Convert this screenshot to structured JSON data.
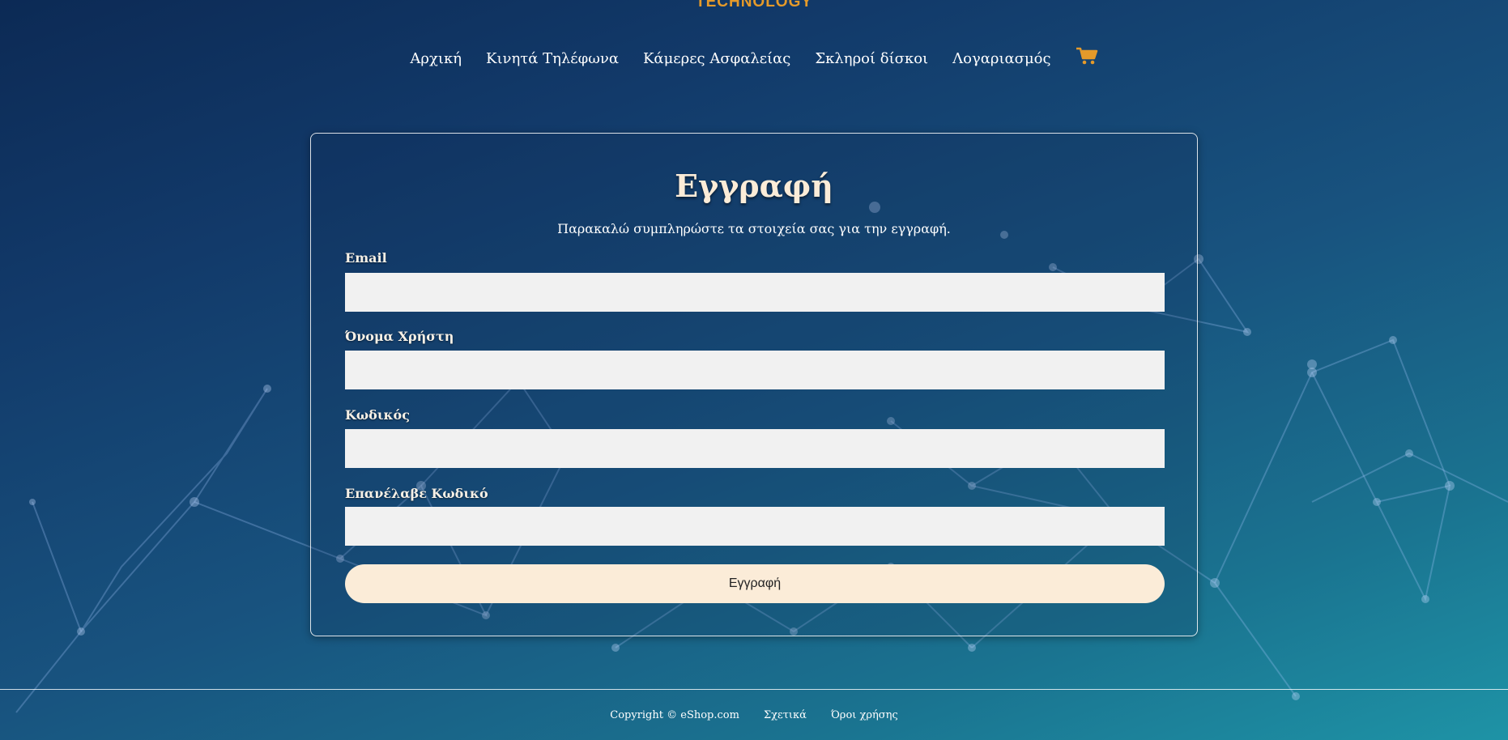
{
  "logo": {
    "text": "TECHNOLOGY"
  },
  "nav": {
    "items": [
      "Αρχική",
      "Κινητά Τηλέφωνα",
      "Κάμερες Ασφαλείας",
      "Σκληροί δίσκοι",
      "Λογαριασμός"
    ],
    "cart_icon": "cart-icon"
  },
  "form": {
    "title": "Εγγραφή",
    "subtitle": "Παρακαλώ συμπληρώστε τα στοιχεία σας για την εγγραφή.",
    "fields": [
      {
        "label": "Email",
        "value": "",
        "placeholder": ""
      },
      {
        "label": "Όνομα Χρήστη",
        "value": "",
        "placeholder": ""
      },
      {
        "label": "Κωδικός",
        "value": "",
        "placeholder": ""
      },
      {
        "label": "Επανέλαβε Κωδικό",
        "value": "",
        "placeholder": ""
      }
    ],
    "submit_label": "Εγγραφή"
  },
  "footer": {
    "copyright": "Copyright © eShop.com",
    "links": [
      "Σχετικά",
      "Όροι χρήσης"
    ]
  },
  "colors": {
    "accent": "#e59a2a",
    "button_bg": "#fbecd8",
    "input_bg": "#f1f1f1"
  }
}
